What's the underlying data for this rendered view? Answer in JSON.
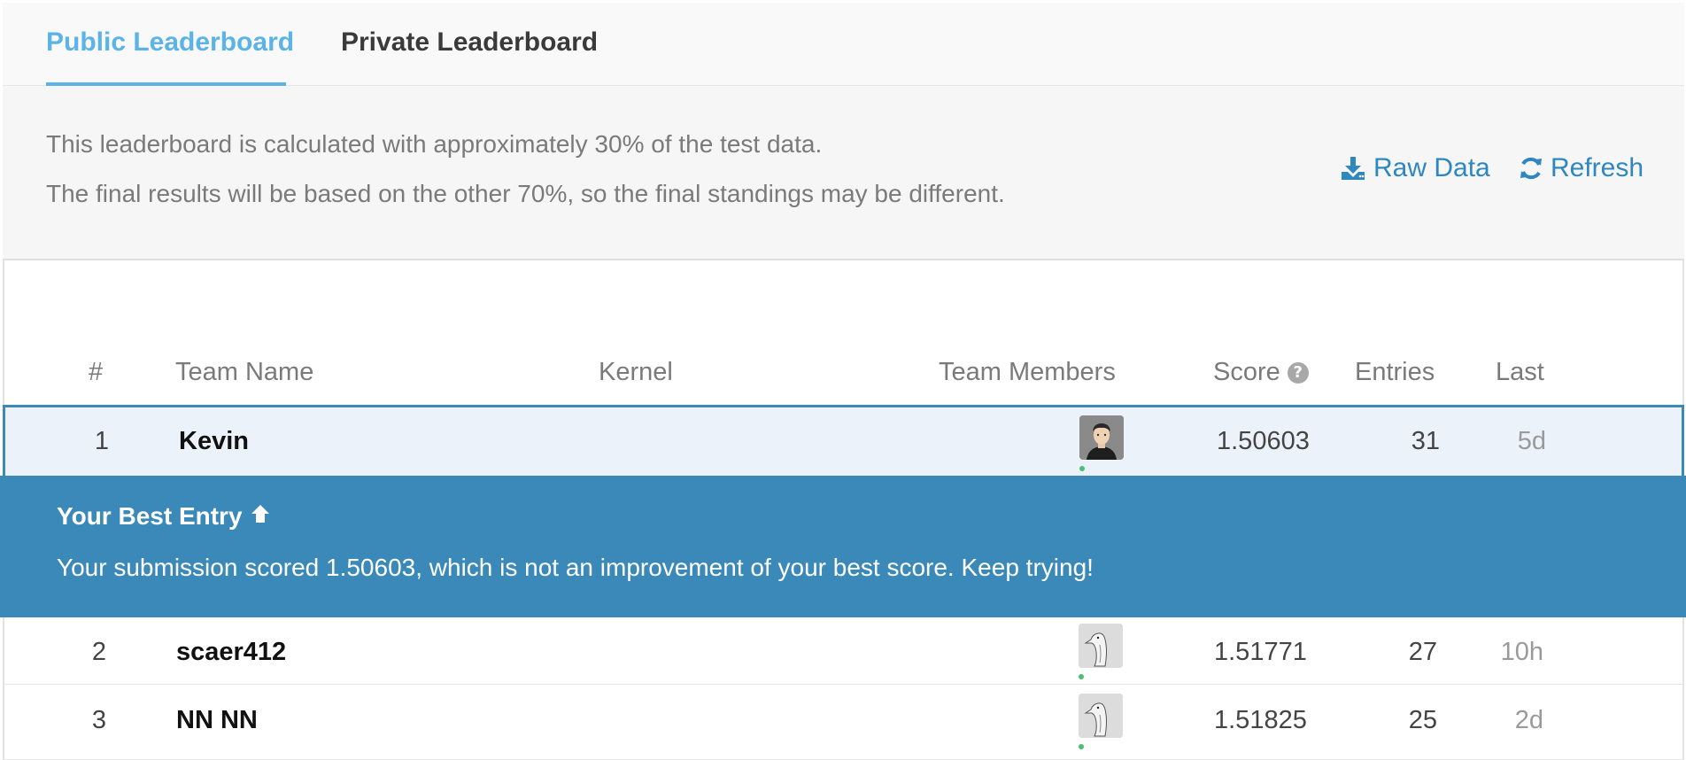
{
  "tabs": [
    {
      "label": "Public Leaderboard",
      "active": true
    },
    {
      "label": "Private Leaderboard",
      "active": false
    }
  ],
  "info": {
    "line1": "This leaderboard is calculated with approximately 30% of the test data.",
    "line2": "The final results will be based on the other 70%, so the final standings may be different."
  },
  "actions": {
    "raw_data": "Raw Data",
    "refresh": "Refresh"
  },
  "table": {
    "headers": {
      "rank": "#",
      "team_name": "Team Name",
      "kernel": "Kernel",
      "team_members": "Team Members",
      "score": "Score",
      "entries": "Entries",
      "last": "Last"
    },
    "rows": [
      {
        "rank": "1",
        "team": "Kevin",
        "score": "1.50603",
        "entries": "31",
        "last": "5d",
        "avatar": "person-avatar"
      },
      {
        "rank": "2",
        "team": "scaer412",
        "score": "1.51771",
        "entries": "27",
        "last": "10h",
        "avatar": "goose-avatar"
      },
      {
        "rank": "3",
        "team": "NN NN",
        "score": "1.51825",
        "entries": "25",
        "last": "2d",
        "avatar": "goose-avatar"
      }
    ]
  },
  "banner": {
    "title": "Your Best Entry",
    "message": "Your submission scored 1.50603, which is not an improvement of your best score. Keep trying!"
  },
  "colors": {
    "accent": "#5bb3e8",
    "link": "#2f87c0",
    "banner": "#3b89b8",
    "highlight_row": "#ebf2f9",
    "online": "#4cbf73"
  }
}
